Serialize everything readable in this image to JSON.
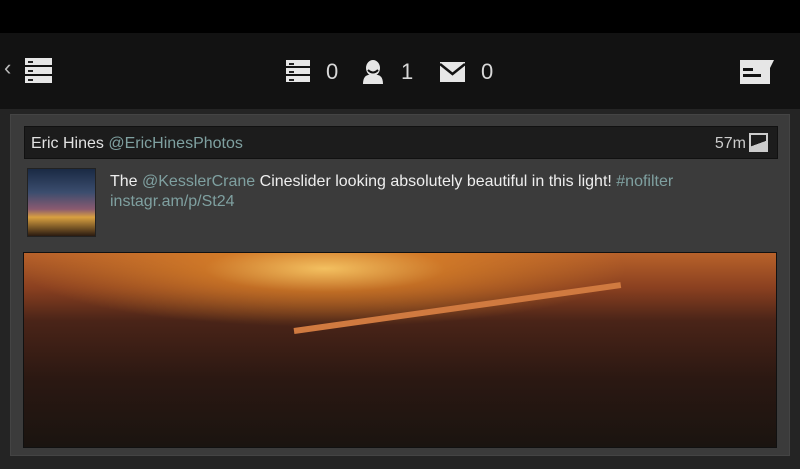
{
  "header": {
    "back": "‹",
    "counts": {
      "lists": "0",
      "followers": "1",
      "messages": "0"
    }
  },
  "tweet": {
    "name": "Eric Hines",
    "handle": "@EricHinesPhotos",
    "time": "57m",
    "text_pre": "The ",
    "mention": "@KesslerCrane",
    "text_mid": " Cineslider looking absolutely beautiful in this light! ",
    "hashtag": "#nofilter",
    "url": "instagr.am/p/St24"
  }
}
